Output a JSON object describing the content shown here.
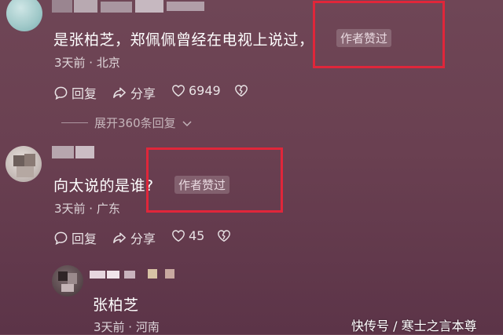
{
  "comments": [
    {
      "text": "是张柏芝，郑佩佩曾经在电视上说过，",
      "badge": "作者赞过",
      "meta": "3天前 · 北京",
      "reply_label": "回复",
      "share_label": "分享",
      "like_count": "6949",
      "expand_label": "展开360条回复"
    },
    {
      "text": "向太说的是谁?",
      "badge": "作者赞过",
      "meta": "3天前 · 广东",
      "reply_label": "回复",
      "share_label": "分享",
      "like_count": "45"
    }
  ],
  "reply": {
    "text": "张柏芝",
    "meta": "3天前 · 河南"
  },
  "watermark": "快传号 / 寒士之言本尊",
  "colors": {
    "background": "#6a4051",
    "highlight_box": "#e0263a",
    "badge_bg": "rgba(255,255,255,0.18)"
  },
  "icons": [
    "comment-icon",
    "share-icon",
    "heart-icon",
    "broken-heart-icon",
    "chevron-down-icon"
  ]
}
